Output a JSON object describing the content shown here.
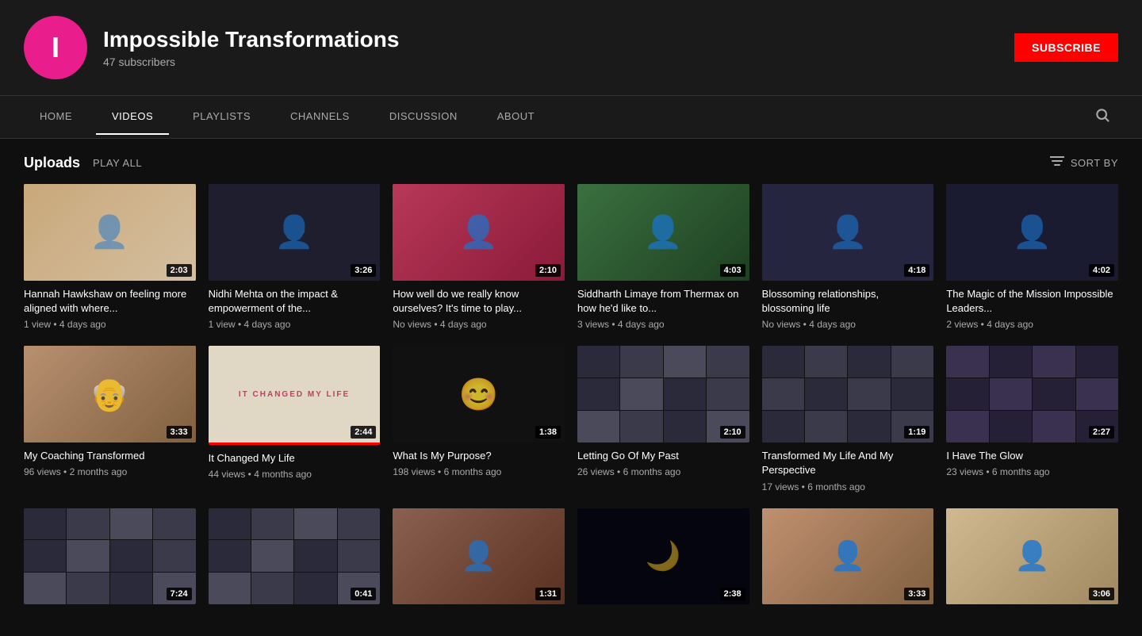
{
  "channel": {
    "avatar_letter": "I",
    "name": "Impossible Transformations",
    "subscribers": "47 subscribers",
    "subscribe_label": "SUBSCRIBE"
  },
  "nav": {
    "tabs": [
      {
        "id": "home",
        "label": "HOME",
        "active": false
      },
      {
        "id": "videos",
        "label": "VIDEOS",
        "active": true
      },
      {
        "id": "playlists",
        "label": "PLAYLISTS",
        "active": false
      },
      {
        "id": "channels",
        "label": "CHANNELS",
        "active": false
      },
      {
        "id": "discussion",
        "label": "DISCUSSION",
        "active": false
      },
      {
        "id": "about",
        "label": "ABOUT",
        "active": false
      }
    ]
  },
  "uploads": {
    "title": "Uploads",
    "play_all": "PLAY ALL",
    "sort_by": "SORT BY"
  },
  "videos_row1": [
    {
      "title": "Hannah Hawkshaw on feeling more aligned with where...",
      "duration": "2:03",
      "views": "1 view",
      "time_ago": "4 days ago",
      "thumb_class": "thumb-1"
    },
    {
      "title": "Nidhi Mehta on the impact & empowerment of the...",
      "duration": "3:26",
      "views": "1 view",
      "time_ago": "4 days ago",
      "thumb_class": "thumb-2"
    },
    {
      "title": "How well do we really know ourselves? It's time to play...",
      "duration": "2:10",
      "views": "No views",
      "time_ago": "4 days ago",
      "thumb_class": "thumb-3"
    },
    {
      "title": "Siddharth Limaye from Thermax on how he'd like to...",
      "duration": "4:03",
      "views": "3 views",
      "time_ago": "4 days ago",
      "thumb_class": "thumb-4"
    },
    {
      "title": "Blossoming relationships, blossoming life",
      "duration": "4:18",
      "views": "No views",
      "time_ago": "4 days ago",
      "thumb_class": "thumb-5"
    },
    {
      "title": "The Magic of the Mission Impossible Leaders...",
      "duration": "4:02",
      "views": "2 views",
      "time_ago": "4 days ago",
      "thumb_class": "thumb-6"
    }
  ],
  "videos_row2": [
    {
      "title": "My Coaching Transformed",
      "duration": "3:33",
      "views": "96 views",
      "time_ago": "2 months ago",
      "thumb_class": "thumb-7",
      "highlighted": false
    },
    {
      "title": "It Changed My Life",
      "duration": "2:44",
      "views": "44 views",
      "time_ago": "4 months ago",
      "thumb_class": "thumb-8",
      "highlighted": true
    },
    {
      "title": "What Is My Purpose?",
      "duration": "1:38",
      "views": "198 views",
      "time_ago": "6 months ago",
      "thumb_class": "thumb-9"
    },
    {
      "title": "Letting Go Of My Past",
      "duration": "2:10",
      "views": "26 views",
      "time_ago": "6 months ago",
      "thumb_class": "thumb-10"
    },
    {
      "title": "Transformed My Life And My Perspective",
      "duration": "1:19",
      "views": "17 views",
      "time_ago": "6 months ago",
      "thumb_class": "thumb-11"
    },
    {
      "title": "I Have The Glow",
      "duration": "2:27",
      "views": "23 views",
      "time_ago": "6 months ago",
      "thumb_class": "thumb-12"
    }
  ],
  "videos_row3": [
    {
      "title": "",
      "duration": "7:24",
      "views": "",
      "time_ago": "",
      "thumb_class": "thumb-13"
    },
    {
      "title": "",
      "duration": "0:41",
      "views": "",
      "time_ago": "",
      "thumb_class": "thumb-14"
    },
    {
      "title": "",
      "duration": "1:31",
      "views": "",
      "time_ago": "",
      "thumb_class": "thumb-15"
    },
    {
      "title": "",
      "duration": "2:38",
      "views": "",
      "time_ago": "",
      "thumb_class": "thumb-16"
    },
    {
      "title": "",
      "duration": "3:33",
      "views": "",
      "time_ago": "",
      "thumb_class": "thumb-17"
    },
    {
      "title": "",
      "duration": "3:06",
      "views": "",
      "time_ago": "",
      "thumb_class": "thumb-18"
    }
  ]
}
